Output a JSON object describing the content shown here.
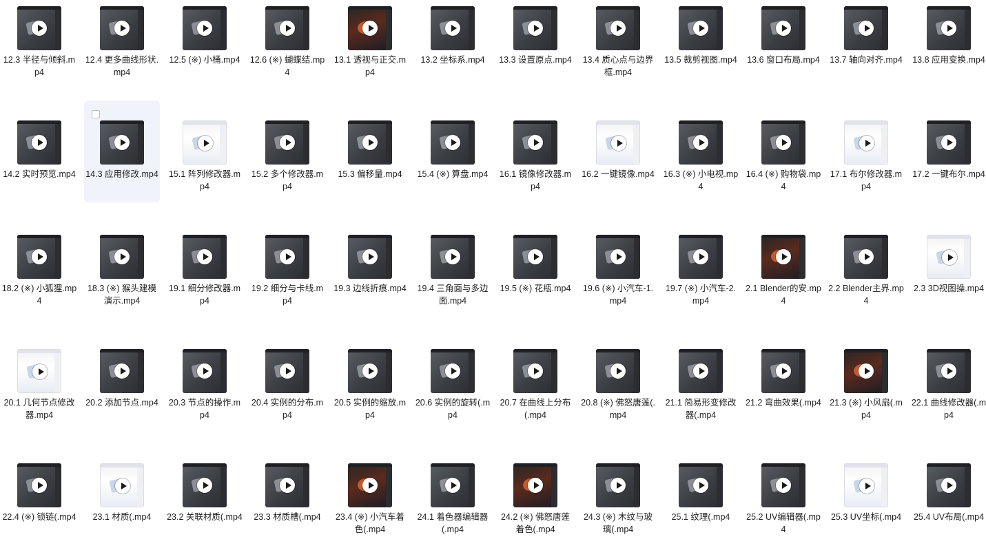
{
  "files": [
    {
      "name": "12.3 半径与倾斜.mp4",
      "thumb": "dark"
    },
    {
      "name": "12.4 更多曲线形状.mp4",
      "thumb": "dark"
    },
    {
      "name": "12.5 (※) 小桶.mp4",
      "thumb": "dark"
    },
    {
      "name": "12.6 (※) 蝴蝶结.mp4",
      "thumb": "dark"
    },
    {
      "name": "13.1 透视与正交.mp4",
      "thumb": "media"
    },
    {
      "name": "13.2 坐标系.mp4",
      "thumb": "dark"
    },
    {
      "name": "13.3 设置原点.mp4",
      "thumb": "dark"
    },
    {
      "name": "13.4 质心点与边界框.mp4",
      "thumb": "dark"
    },
    {
      "name": "13.5 裁剪视图.mp4",
      "thumb": "dark"
    },
    {
      "name": "13.6 窗口布局.mp4",
      "thumb": "dark"
    },
    {
      "name": "13.7 轴向对齐.mp4",
      "thumb": "dark"
    },
    {
      "name": "13.8 应用变换.mp4",
      "thumb": "dark"
    },
    {
      "name": "14.2 实时预览.mp4",
      "thumb": "dark"
    },
    {
      "name": "14.3 应用修改.mp4",
      "thumb": "dark",
      "selected": true
    },
    {
      "name": "15.1 阵列修改器.mp4",
      "thumb": "light"
    },
    {
      "name": "15.2 多个修改器.mp4",
      "thumb": "dark"
    },
    {
      "name": "15.3 偏移量.mp4",
      "thumb": "dark"
    },
    {
      "name": "15.4 (※) 算盘.mp4",
      "thumb": "dark"
    },
    {
      "name": "16.1 镜像修改器.mp4",
      "thumb": "dark"
    },
    {
      "name": "16.2 一键镜像.mp4",
      "thumb": "light"
    },
    {
      "name": "16.3 (※) 小电视.mp4",
      "thumb": "dark"
    },
    {
      "name": "16.4 (※) 购物袋.mp4",
      "thumb": "dark"
    },
    {
      "name": "17.1 布尔修改器.mp4",
      "thumb": "light"
    },
    {
      "name": "17.2 一键布尔.mp4",
      "thumb": "dark"
    },
    {
      "name": "18.2 (※) 小狐狸.mp4",
      "thumb": "dark"
    },
    {
      "name": "18.3 (※) 猴头建模演示.mp4",
      "thumb": "dark"
    },
    {
      "name": "19.1 细分修改器.mp4",
      "thumb": "dark"
    },
    {
      "name": "19.2 细分与卡线.mp4",
      "thumb": "dark"
    },
    {
      "name": "19.3 边线折痕.mp4",
      "thumb": "dark"
    },
    {
      "name": "19.4 三角面与多边面.mp4",
      "thumb": "dark"
    },
    {
      "name": "19.5 (※) 花瓶.mp4",
      "thumb": "dark"
    },
    {
      "name": "19.6 (※) 小汽车-1.mp4",
      "thumb": "dark"
    },
    {
      "name": "19.7 (※) 小汽车-2.mp4",
      "thumb": "dark"
    },
    {
      "name": "2.1 Blender的安.mp4",
      "thumb": "media"
    },
    {
      "name": "2.2 Blender主界.mp4",
      "thumb": "dark"
    },
    {
      "name": "2.3 3D视图操.mp4",
      "thumb": "light"
    },
    {
      "name": "20.1 几何节点修改器.mp4",
      "thumb": "light"
    },
    {
      "name": "20.2 添加节点.mp4",
      "thumb": "dark"
    },
    {
      "name": "20.3 节点的操作.mp4",
      "thumb": "dark"
    },
    {
      "name": "20.4 实例的分布.mp4",
      "thumb": "dark"
    },
    {
      "name": "20.5 实例的缩放.mp4",
      "thumb": "dark"
    },
    {
      "name": "20.6 实例的旋转(.mp4",
      "thumb": "dark"
    },
    {
      "name": "20.7 在曲线上分布(.mp4",
      "thumb": "dark"
    },
    {
      "name": "20.8 (※) 佛怒唐莲(.mp4",
      "thumb": "dark"
    },
    {
      "name": "21.1 简易形变修改器(.mp4",
      "thumb": "dark"
    },
    {
      "name": "21.2 弯曲效果(.mp4",
      "thumb": "dark"
    },
    {
      "name": "21.3 (※) 小风扇(.mp4",
      "thumb": "media"
    },
    {
      "name": "22.1 曲线修改器(.mp4",
      "thumb": "dark"
    },
    {
      "name": "22.4 (※) 锁链(.mp4",
      "thumb": "dark"
    },
    {
      "name": "23.1 材质(.mp4",
      "thumb": "light"
    },
    {
      "name": "23.2 关联材质(.mp4",
      "thumb": "dark"
    },
    {
      "name": "23.3 材质槽(.mp4",
      "thumb": "dark"
    },
    {
      "name": "23.4 (※) 小汽车着色(.mp4",
      "thumb": "media"
    },
    {
      "name": "24.1 着色器编辑器(.mp4",
      "thumb": "dark"
    },
    {
      "name": "24.2 (※) 佛怒唐莲 着色(.mp4",
      "thumb": "media"
    },
    {
      "name": "24.3 (※) 木纹与玻璃(.mp4",
      "thumb": "dark"
    },
    {
      "name": "25.1 纹理(.mp4",
      "thumb": "dark"
    },
    {
      "name": "25.2 UV编辑器(.mp4",
      "thumb": "dark"
    },
    {
      "name": "25.3 UV坐标(.mp4",
      "thumb": "light"
    },
    {
      "name": "25.4 UV布局(.mp4",
      "thumb": "dark"
    }
  ]
}
